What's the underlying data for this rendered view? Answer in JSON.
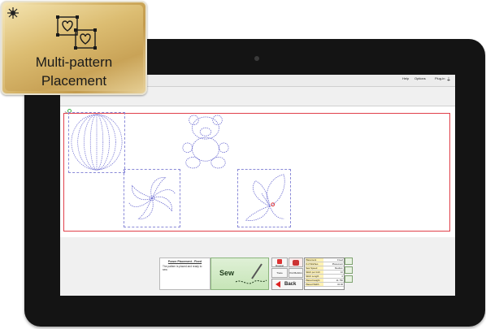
{
  "badge": {
    "title_line1": "Multi-pattern",
    "title_line2": "Placement",
    "icon": "heart-frames-icon",
    "corner_icon": "sunburst-icon",
    "color": "#d4b266"
  },
  "topbar": {
    "help": "Help",
    "options": "Options",
    "plug_in": "Plug-in"
  },
  "canvas": {
    "quilt_border_color": "#e0404a",
    "patterns": [
      "striped-ball-pattern",
      "teddy-bear-pattern",
      "pinwheel-pattern",
      "butterfly-pattern"
    ]
  },
  "message_panel": {
    "title": "Power Placement - Fixed",
    "text": "The pattern is placed and ready to sew."
  },
  "sew_button": {
    "label": "Sew"
  },
  "controls": {
    "repeat_label": "Repeat Pattern",
    "trace_label": "Trace",
    "pull_label": "Pull Bobbin",
    "back_label": "Back"
  },
  "info_table": [
    {
      "key": "Placement",
      "value": "Fixed"
    },
    {
      "key": "# of Stitches",
      "value": "Placement"
    },
    {
      "key": "Sew Speed",
      "value": "Medium"
    },
    {
      "key": "Stitch per Inch",
      "value": "10"
    },
    {
      "key": "Stitch Length",
      "value": "0"
    },
    {
      "key": "Placed Height",
      "value": "11.750"
    },
    {
      "key": "Placed Width",
      "value": "34.00"
    }
  ],
  "colors": {
    "tablet_bezel": "#141414",
    "pattern_line": "#6a6ad0",
    "sew_green": "#c6e5b7"
  }
}
